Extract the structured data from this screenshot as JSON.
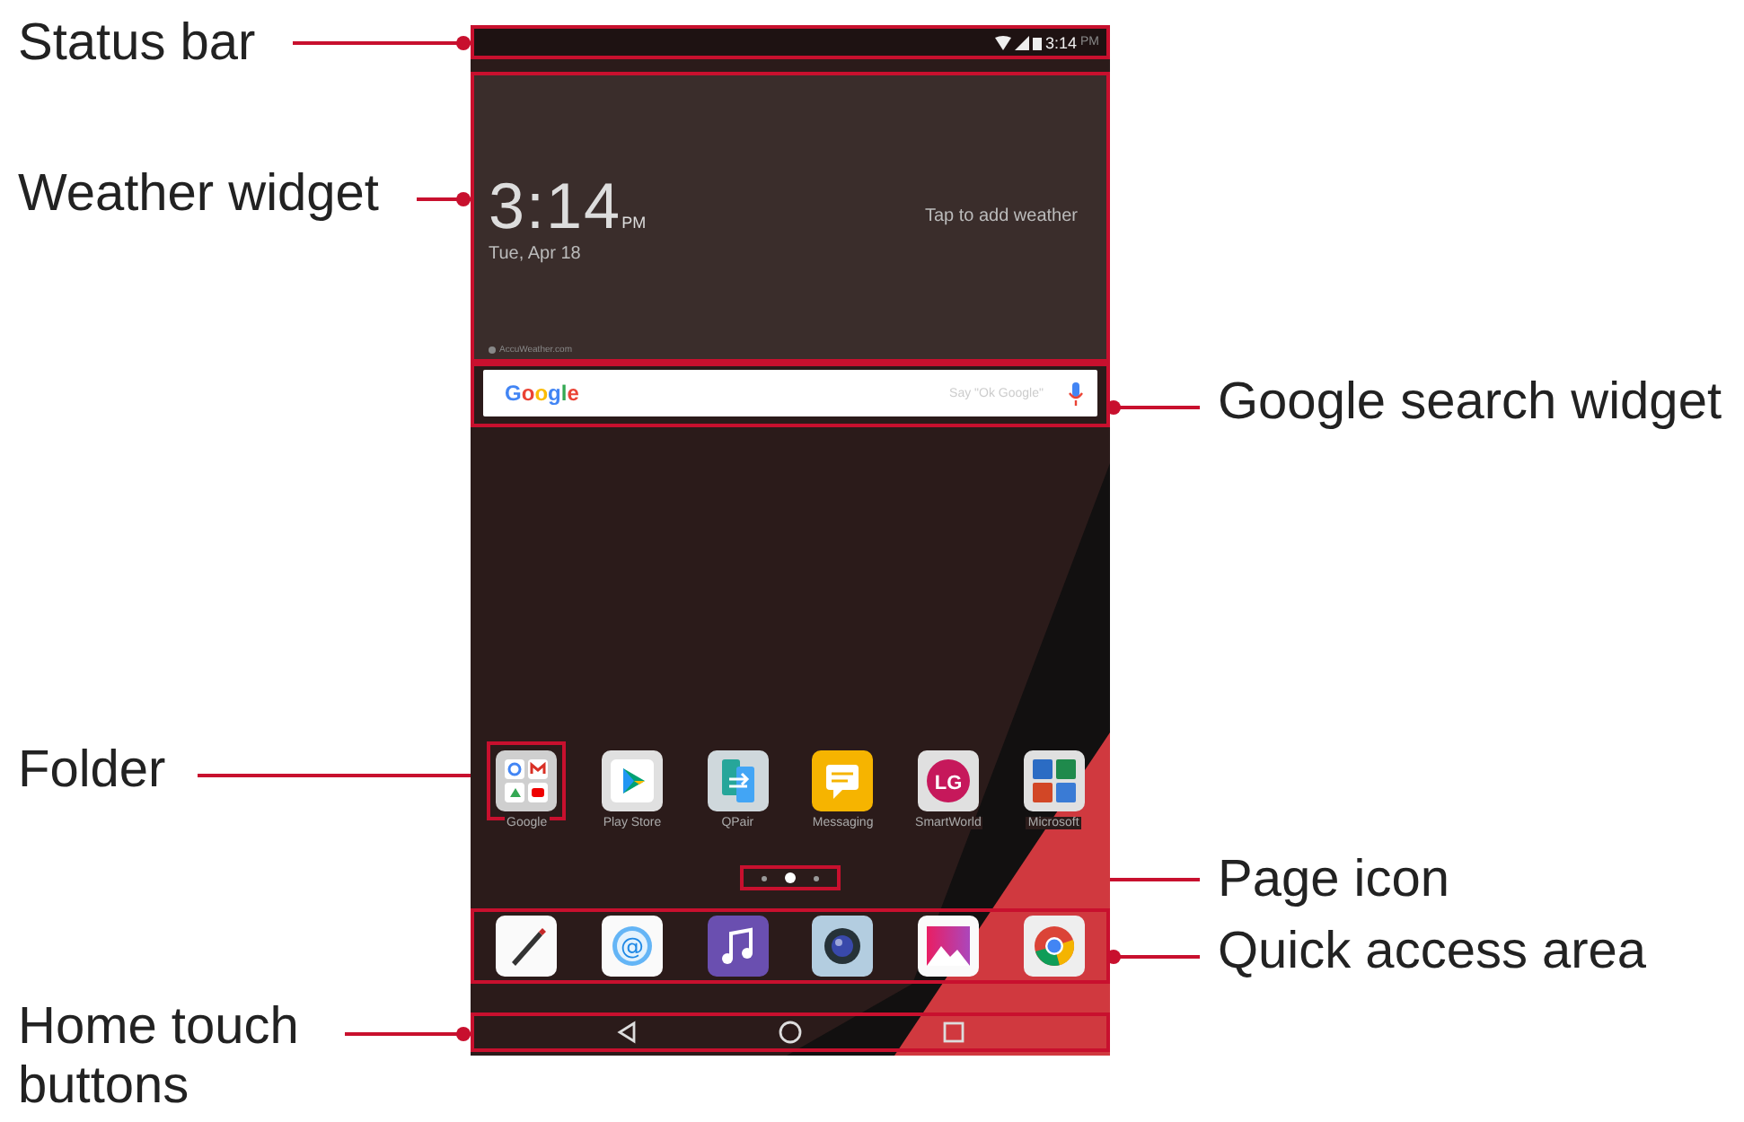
{
  "callouts": [
    {
      "label": "Status bar"
    },
    {
      "label": "Weather widget"
    },
    {
      "label": "Google search widget"
    },
    {
      "label": "Folder"
    },
    {
      "label": "Page icon"
    },
    {
      "label": "Quick access area"
    },
    {
      "label": "Home touch buttons"
    }
  ],
  "status_bar": {
    "time": "3:14",
    "ampm": "PM"
  },
  "weather_widget": {
    "time": "3:14",
    "ampm": "PM",
    "date": "Tue, Apr 18",
    "prompt": "Tap to add weather",
    "attribution": "AccuWeather.com"
  },
  "search_widget": {
    "logo": "Google",
    "placeholder": "Say \"Ok Google\""
  },
  "apps": [
    {
      "kind": "folder",
      "label": "Google"
    },
    {
      "kind": "play",
      "label": "Play Store"
    },
    {
      "kind": "qpair",
      "label": "QPair"
    },
    {
      "kind": "messaging",
      "label": "Messaging"
    },
    {
      "kind": "lg",
      "label": "SmartWorld",
      "glyph": "LG"
    },
    {
      "kind": "office",
      "label": "Microsoft"
    }
  ],
  "page_dots": [
    {
      "selected": false
    },
    {
      "selected": true
    },
    {
      "selected": false
    }
  ],
  "dock": [
    {
      "kind": "pen"
    },
    {
      "kind": "email",
      "glyph": "@"
    },
    {
      "kind": "music"
    },
    {
      "kind": "camera"
    },
    {
      "kind": "gallery"
    },
    {
      "kind": "chrome"
    }
  ],
  "nav_buttons": [
    {
      "kind": "back"
    },
    {
      "kind": "home"
    },
    {
      "kind": "recents"
    }
  ]
}
